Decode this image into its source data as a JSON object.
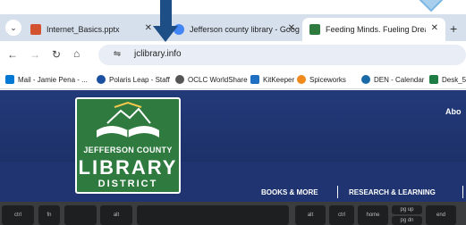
{
  "tabs": [
    {
      "title": "Internet_Basics.pptx",
      "favicon_color": "#d35230"
    },
    {
      "title": "Jefferson county library - Goog",
      "favicon_color": "#4285f4"
    },
    {
      "title": "Feeding Minds. Fueling Dreams",
      "favicon_color": "#2e7a3f"
    }
  ],
  "address": {
    "url": "jclibrary.info"
  },
  "bookmarks": [
    {
      "label": "Mail - Jamie Pena - ...",
      "color": "#0078d4"
    },
    {
      "label": "Polaris Leap - Staff",
      "color": "#1a4fa0"
    },
    {
      "label": "OCLC WorldShare",
      "color": "#555555"
    },
    {
      "label": "KitKeeper",
      "color": "#1f6fc2"
    },
    {
      "label": "Spiceworks",
      "color": "#f18a1c"
    },
    {
      "label": "DEN - Calendar",
      "color": "#1a6aa8"
    },
    {
      "label": "Desk_5",
      "color": "#1e7c45"
    }
  ],
  "site": {
    "about": "Abo",
    "logo_line1": "JEFFERSON COUNTY",
    "logo_line2": "LIBRARY",
    "logo_line3": "DISTRICT",
    "nav": [
      "BOOKS & MORE",
      "RESEARCH & LEARNING"
    ]
  },
  "keyboard": {
    "left": [
      "ctrl",
      "fn",
      "alt"
    ],
    "right": [
      "alt",
      "ctrl",
      "home",
      "pg up",
      "pg dn",
      "end"
    ]
  }
}
